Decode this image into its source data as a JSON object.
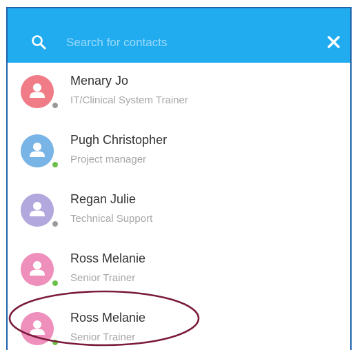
{
  "search": {
    "placeholder": "Search for contacts",
    "value": "",
    "icon": "search-icon",
    "close_icon": "close-icon"
  },
  "colors": {
    "header": "#21acf0",
    "frame_border": "#1f63a8",
    "highlight_ring": "#7a1a3a",
    "status_online": "#6cc04a",
    "status_offline": "#9a9a9a"
  },
  "contacts": [
    {
      "name": "Menary Jo",
      "role": "IT/Clinical System Trainer",
      "avatar_color": "#f07c87",
      "status": "offline"
    },
    {
      "name": "Pugh Christopher",
      "role": "Project manager",
      "avatar_color": "#79b4e6",
      "status": "online"
    },
    {
      "name": "Regan Julie",
      "role": "Technical Support",
      "avatar_color": "#b3a8de",
      "status": "offline"
    },
    {
      "name": "Ross Melanie",
      "role": "Senior Trainer",
      "avatar_color": "#ef8fbb",
      "status": "online"
    },
    {
      "name": "Ross Melanie",
      "role": "Senior Trainer",
      "avatar_color": "#ef8fbb",
      "status": "online",
      "highlighted": true
    }
  ]
}
